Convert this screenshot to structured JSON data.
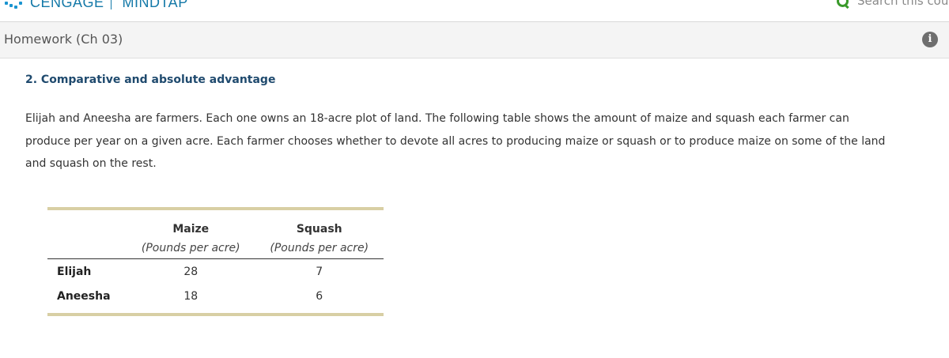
{
  "header": {
    "brand": "CENGAGE",
    "product": "MINDTAP",
    "search_placeholder": "Search this cou",
    "accent_color": "#1479a8",
    "search_icon_color": "#3a9a2a"
  },
  "titlebar": {
    "title": "Homework (Ch 03)",
    "info_icon": "i"
  },
  "question": {
    "heading": "2. Comparative and absolute advantage",
    "body": "Elijah and Aneesha are farmers. Each one owns an 18-acre plot of land. The following table shows the amount of maize and squash each farmer can produce per year on a given acre. Each farmer chooses whether to devote all acres to producing maize or squash or to produce maize on some of the land and squash on the rest."
  },
  "table": {
    "columns": [
      {
        "header": "Maize",
        "units": "(Pounds per acre)"
      },
      {
        "header": "Squash",
        "units": "(Pounds per acre)"
      }
    ],
    "rows": [
      {
        "name": "Elijah",
        "values": [
          "28",
          "7"
        ]
      },
      {
        "name": "Aneesha",
        "values": [
          "18",
          "6"
        ]
      }
    ]
  }
}
